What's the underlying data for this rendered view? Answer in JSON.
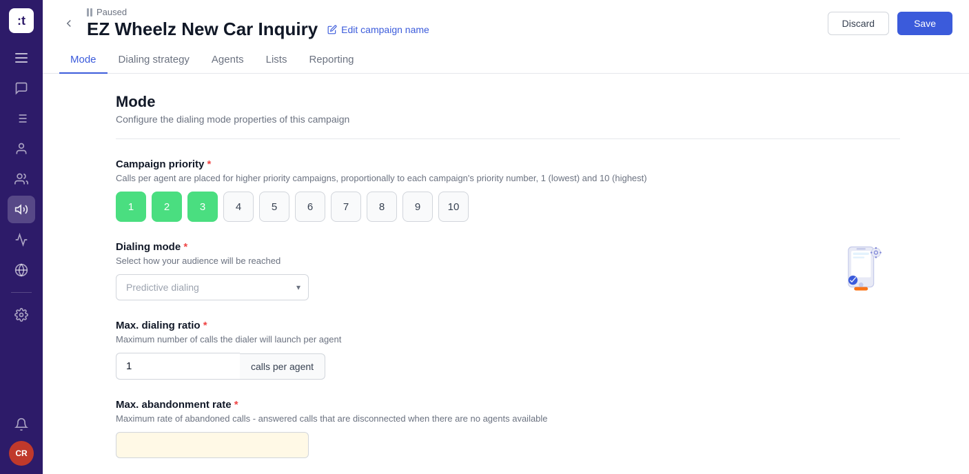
{
  "sidebar": {
    "logo": ":t",
    "avatar_initials": "CR",
    "icons": [
      {
        "name": "menu-icon",
        "glyph": "☰"
      },
      {
        "name": "conversations-icon",
        "glyph": "💬"
      },
      {
        "name": "lists-icon",
        "glyph": "☰"
      },
      {
        "name": "contacts-icon",
        "glyph": "👤"
      },
      {
        "name": "agents-icon",
        "glyph": "👥"
      },
      {
        "name": "campaigns-icon",
        "glyph": "📢"
      },
      {
        "name": "analytics-icon",
        "glyph": "📊"
      },
      {
        "name": "globe-icon",
        "glyph": "🌐"
      },
      {
        "name": "settings-icon",
        "glyph": "⚙"
      },
      {
        "name": "bell-icon",
        "glyph": "🔔"
      }
    ]
  },
  "header": {
    "status": "Paused",
    "campaign_title": "EZ Wheelz New Car Inquiry",
    "edit_label": "Edit campaign name",
    "discard_label": "Discard",
    "save_label": "Save"
  },
  "tabs": [
    {
      "label": "Mode",
      "active": true
    },
    {
      "label": "Dialing strategy",
      "active": false
    },
    {
      "label": "Agents",
      "active": false
    },
    {
      "label": "Lists",
      "active": false
    },
    {
      "label": "Reporting",
      "active": false
    }
  ],
  "mode": {
    "title": "Mode",
    "subtitle": "Configure the dialing mode properties of this campaign",
    "campaign_priority": {
      "label": "Campaign priority",
      "description": "Calls per agent are placed for higher priority campaigns, proportionally to each campaign's priority number, 1 (lowest) and 10 (highest)",
      "options": [
        1,
        2,
        3,
        4,
        5,
        6,
        7,
        8,
        9,
        10
      ],
      "selected": [
        1,
        2,
        3
      ]
    },
    "dialing_mode": {
      "label": "Dialing mode",
      "description": "Select how your audience will be reached",
      "value": "Predictive dialing",
      "placeholder": "Predictive dialing"
    },
    "max_dialing_ratio": {
      "label": "Max. dialing ratio",
      "description": "Maximum number of calls the dialer will launch per agent",
      "value": "1",
      "unit": "calls per agent"
    },
    "max_abandonment_rate": {
      "label": "Max. abandonment rate",
      "description": "Maximum rate of abandoned calls - answered calls that are disconnected when there are no agents available"
    }
  }
}
